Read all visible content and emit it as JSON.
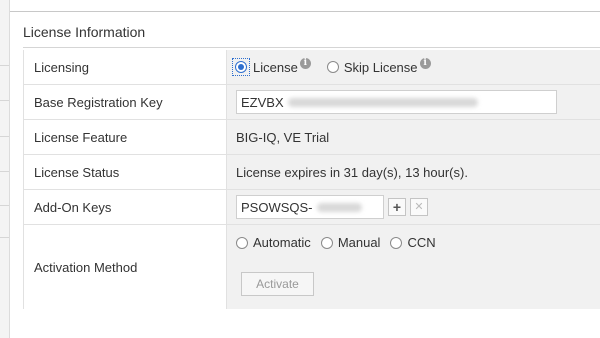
{
  "section": {
    "title": "License Information"
  },
  "rows": {
    "licensing": {
      "label": "Licensing",
      "options": [
        {
          "label": "License",
          "selected": true,
          "info_icon": "info-icon"
        },
        {
          "label": "Skip License",
          "selected": false,
          "info_icon": "info-icon"
        }
      ]
    },
    "base_key": {
      "label": "Base Registration Key",
      "value": "EZVBX"
    },
    "feature": {
      "label": "License Feature",
      "value": "BIG-IQ, VE Trial"
    },
    "status": {
      "label": "License Status",
      "value": "License expires in 31 day(s), 13 hour(s)."
    },
    "addon": {
      "label": "Add-On Keys",
      "value": "PSOWSQS-",
      "add_icon": "plus-icon",
      "remove_icon": "close-icon"
    },
    "activation": {
      "label": "Activation Method",
      "options": [
        {
          "label": "Automatic",
          "selected": false
        },
        {
          "label": "Manual",
          "selected": false
        },
        {
          "label": "CCN",
          "selected": false
        }
      ],
      "button_label": "Activate"
    }
  },
  "colors": {
    "accent": "#2f6fce",
    "value_bg": "#f1f1f1",
    "border": "#e1e1e1"
  }
}
